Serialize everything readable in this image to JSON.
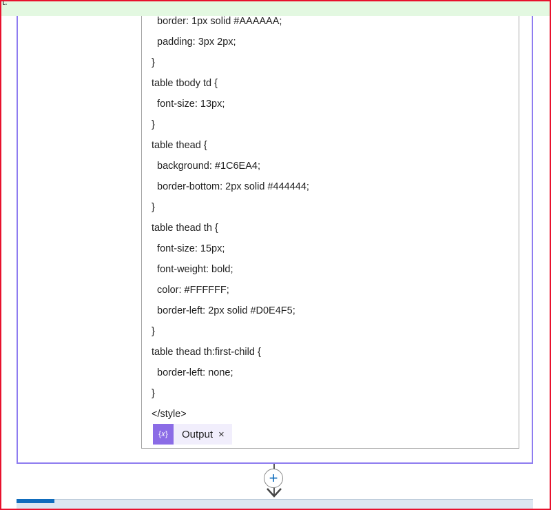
{
  "banner": {
    "text": "t."
  },
  "code_lines": [
    "  border: 1px solid #AAAAAA;",
    "  padding: 3px 2px;",
    "}",
    "table tbody td {",
    "  font-size: 13px;",
    "}",
    "table thead {",
    "  background: #1C6EA4;",
    "  border-bottom: 2px solid #444444;",
    "}",
    "table thead th {",
    "  font-size: 15px;",
    "  font-weight: bold;",
    "  color: #FFFFFF;",
    "  border-left: 2px solid #D0E4F5;",
    "}",
    "table thead th:first-child {",
    "  border-left: none;",
    "}",
    "</style>"
  ],
  "token": {
    "icon_text": "{𝑥}",
    "label": "Output",
    "remove_glyph": "×"
  },
  "add_step": {
    "glyph": "+"
  },
  "colors": {
    "accent": "#8e7cf0",
    "token_icon": "#8b6ce6",
    "link_blue": "#0f6cbd",
    "frame_red": "#e8112d"
  }
}
